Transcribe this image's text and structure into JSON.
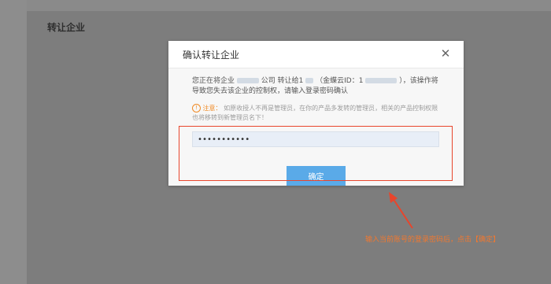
{
  "page": {
    "title": "转让企业"
  },
  "dialog": {
    "title": "确认转让企业",
    "close_symbol": "✕",
    "desc_part1": "您正在将企业",
    "desc_part2": "公司",
    "desc_part3": "转让给1",
    "desc_part4": "（金蝶云ID：1",
    "desc_part5": "），该操作将导致您失去该企业的控制权，请输入登录密码确认",
    "notice_label": "注意：",
    "notice_text": "如原收授人不再是管理员，在你的产品多发转的管理员，相关的产品控制权限也将移转到新管理员名下！",
    "password_value": "•••••••••••",
    "confirm_label": "确定"
  },
  "annotation": {
    "tip": "输入当前账号的登录密码后，点击【确定】",
    "color": "#e8452c"
  }
}
